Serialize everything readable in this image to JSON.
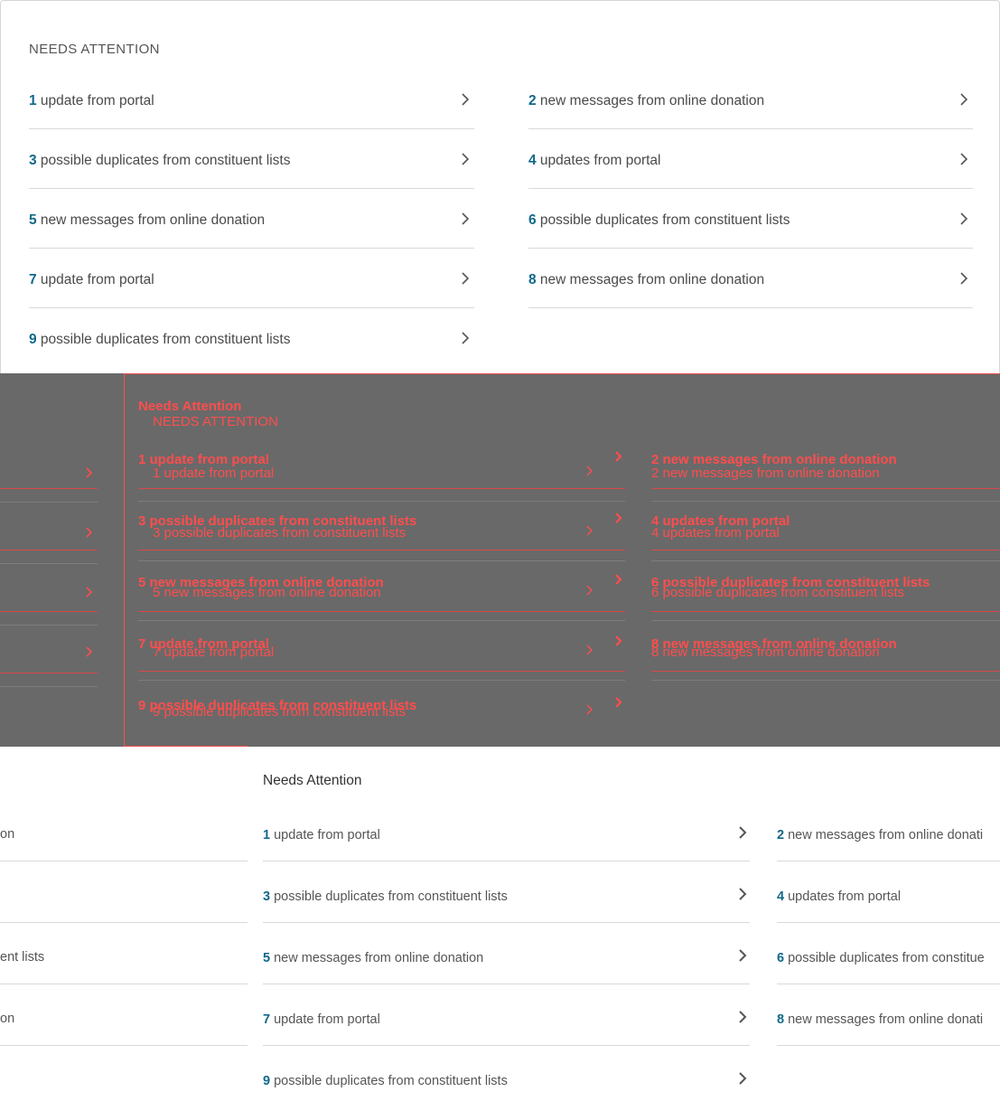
{
  "section1": {
    "title": "NEEDS ATTENTION",
    "left_items": [
      {
        "num": "1",
        "text": " update from portal"
      },
      {
        "num": "3",
        "text": " possible duplicates from constituent lists"
      },
      {
        "num": "5",
        "text": " new messages from online donation"
      },
      {
        "num": "7",
        "text": " update from portal"
      },
      {
        "num": "9",
        "text": " possible duplicates from constituent lists"
      }
    ],
    "right_items": [
      {
        "num": "2",
        "text": " new messages from online donation"
      },
      {
        "num": "4",
        "text": " updates from portal"
      },
      {
        "num": "6",
        "text": " possible duplicates from constituent lists"
      },
      {
        "num": "8",
        "text": " new messages from online donation"
      }
    ]
  },
  "debug": {
    "title_a": "Needs Attention",
    "title_b": "NEEDS ATTENTION",
    "left_items": [
      "1 update from portal",
      "3 possible duplicates from constituent lists",
      "5 new messages from online donation",
      "7 update from portal",
      "9 possible duplicates from constituent lists"
    ],
    "right_items": [
      "2 new messages from online donation",
      "4 updates from portal",
      "6 possible duplicates from constituent lists",
      "8 new messages from online donation"
    ]
  },
  "section3": {
    "title": "Needs Attention",
    "left_items": [
      {
        "num": "1",
        "text": " update from portal"
      },
      {
        "num": "3",
        "text": " possible duplicates from constituent lists"
      },
      {
        "num": "5",
        "text": " new messages from online donation"
      },
      {
        "num": "7",
        "text": " update from portal"
      },
      {
        "num": "9",
        "text": " possible duplicates from constituent lists"
      }
    ],
    "right_items": [
      {
        "num": "2",
        "text": " new messages from online donati"
      },
      {
        "num": "4",
        "text": " updates from portal"
      },
      {
        "num": "6",
        "text": " possible duplicates from constitue"
      },
      {
        "num": "8",
        "text": " new messages from online donati"
      }
    ],
    "offscreen_left_fragments": [
      "on",
      "ent lists",
      "on"
    ]
  },
  "colors": {
    "accent_number": "#11688a",
    "debug_red": "#ff4d4d",
    "debug_bg": "#696969"
  },
  "icons": {
    "row_chevron": "chevron-right-icon"
  }
}
